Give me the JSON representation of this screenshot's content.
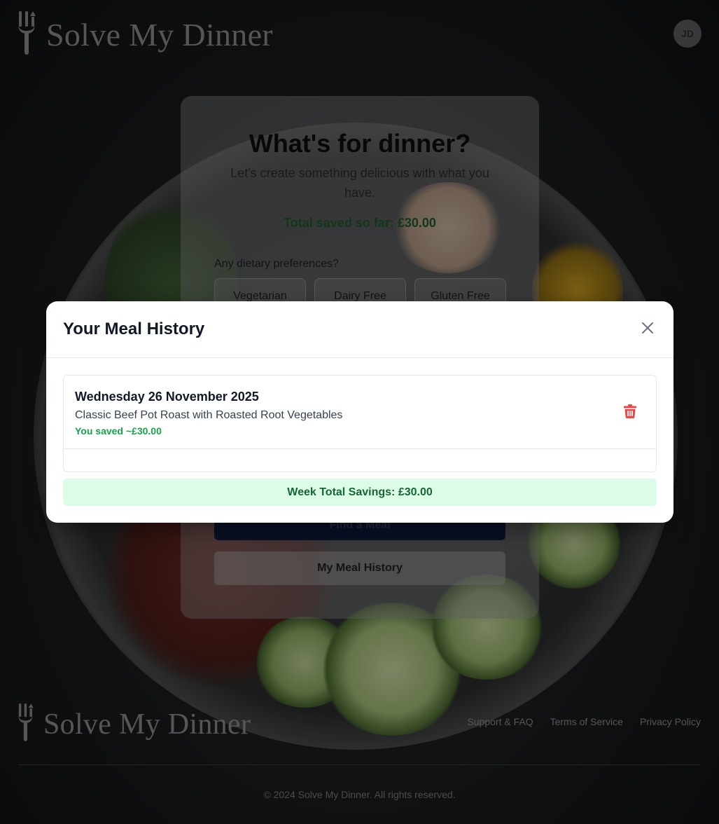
{
  "app": {
    "name": "Solve My Dinner",
    "user_initials": "JD"
  },
  "hero": {
    "title": "What's for dinner?",
    "subtitle": "Let's create something delicious with what you have.",
    "total_saved": "Total saved so far: £30.00",
    "dietary_label": "Any dietary preferences?",
    "dietary_options": [
      "Vegetarian",
      "Dairy Free",
      "Gluten Free"
    ],
    "find_button": "Find a Meal",
    "history_button": "My Meal History"
  },
  "modal": {
    "title": "Your Meal History",
    "entries": [
      {
        "date": "Wednesday 26 November 2025",
        "meal": "Classic Beef Pot Roast with Roasted Root Vegetables",
        "saved": "You saved ~£30.00"
      }
    ],
    "week_total": "Week Total Savings: £30.00"
  },
  "footer": {
    "links": [
      "Support & FAQ",
      "Terms of Service",
      "Privacy Policy"
    ],
    "copyright": "© 2024 Solve My Dinner. All rights reserved."
  },
  "colors": {
    "saved_green": "#16a34a",
    "week_total_bg": "#dcfce7",
    "delete_red": "#ef4444",
    "primary_navy": "#1e3a8a"
  },
  "icons": {
    "logo": "fork-icon",
    "close": "close-icon",
    "delete": "trash-icon"
  }
}
